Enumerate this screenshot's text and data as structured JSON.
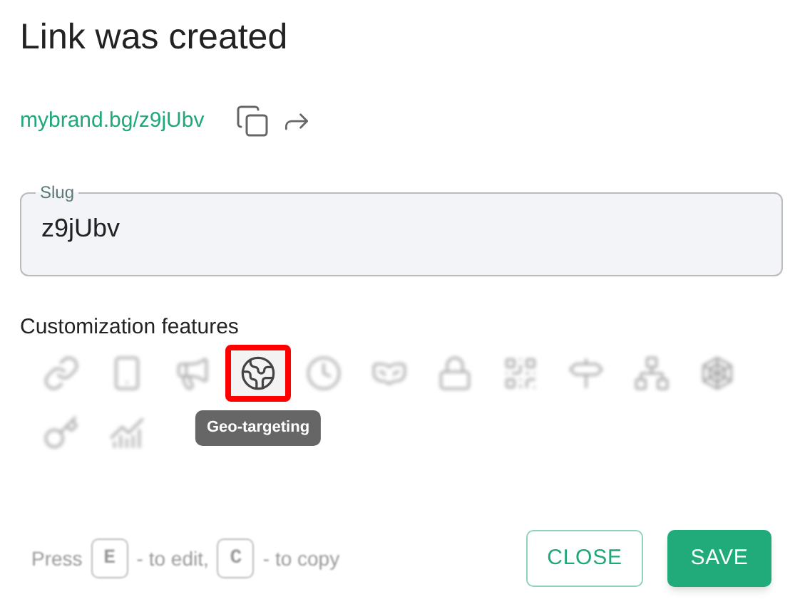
{
  "title": "Link was created",
  "short_link": "mybrand.bg/z9jUbv",
  "slug": {
    "label": "Slug",
    "value": "z9jUbv"
  },
  "features": {
    "label": "Customization features",
    "items": [
      {
        "kind": "link",
        "selected": false
      },
      {
        "kind": "phone",
        "selected": false
      },
      {
        "kind": "megaphone",
        "selected": false
      },
      {
        "kind": "globe",
        "selected": true,
        "tooltip": "Geo-targeting"
      },
      {
        "kind": "clock",
        "selected": false
      },
      {
        "kind": "spy",
        "selected": false
      },
      {
        "kind": "lock",
        "selected": false
      },
      {
        "kind": "qr",
        "selected": false
      },
      {
        "kind": "signpost",
        "selected": false
      },
      {
        "kind": "network",
        "selected": false
      },
      {
        "kind": "web",
        "selected": false
      },
      {
        "kind": "key",
        "selected": false
      },
      {
        "kind": "chart",
        "selected": false
      }
    ]
  },
  "hint": {
    "press": "Press",
    "key_edit": "E",
    "edit": "- to edit,",
    "key_copy": "C",
    "copy": "- to copy"
  },
  "buttons": {
    "close": "CLOSE",
    "save": "SAVE"
  }
}
